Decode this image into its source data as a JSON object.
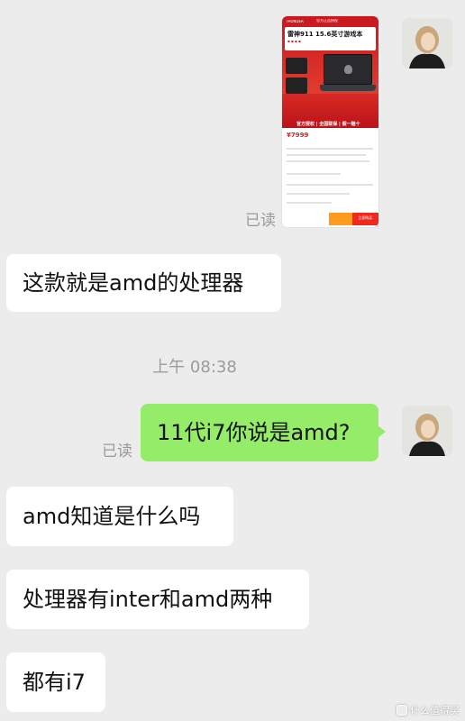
{
  "messages": {
    "image_read": "已读",
    "msg1": "这款就是amd的处理器",
    "timestamp": "上午 08:38",
    "msg2": "11代i7你说是amd?",
    "msg2_read": "已读",
    "msg3": "amd知道是什么吗",
    "msg4": "处理器有inter和amd两种",
    "msg5": "都有i7"
  },
  "product_screenshot": {
    "banner": "官方正品授权",
    "title": "雷神911 15.6英寸游戏本",
    "slogan": "官方授权 | 全国联保 | 假一赔十",
    "price": "¥7999",
    "buy_button": "立即购买"
  },
  "watermark": "什么值得买",
  "icons": [
    "avatar",
    "laptop-image",
    "watermark-logo-icon"
  ],
  "colors": {
    "background": "#ececec",
    "incoming_bubble": "#ffffff",
    "outgoing_bubble": "#95ec69",
    "product_red": "#c9171e"
  }
}
